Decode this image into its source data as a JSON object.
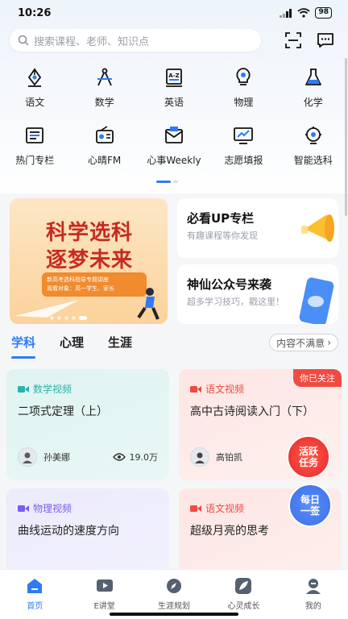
{
  "status": {
    "time": "10:26",
    "battery": "98"
  },
  "search": {
    "placeholder": "搜索课程、老师、知识点"
  },
  "grid": {
    "row1": [
      {
        "label": "语文",
        "icon": "pen-nib-icon"
      },
      {
        "label": "数学",
        "icon": "compass-icon"
      },
      {
        "label": "英语",
        "icon": "az-book-icon"
      },
      {
        "label": "物理",
        "icon": "lightbulb-icon"
      },
      {
        "label": "化学",
        "icon": "flask-icon"
      }
    ],
    "row2": [
      {
        "label": "热门专栏",
        "icon": "newspaper-icon"
      },
      {
        "label": "心晴FM",
        "icon": "radio-icon"
      },
      {
        "label": "心事Weekly",
        "icon": "envelope-icon"
      },
      {
        "label": "志愿填报",
        "icon": "chart-board-icon"
      },
      {
        "label": "智能选科",
        "icon": "bulb-gear-icon"
      }
    ]
  },
  "banner": {
    "line1": "科学选科",
    "line2": "逐梦未来",
    "box_line1": "新高考选科指导专题讲座",
    "box_line2": "观看对象：高一学生、家长"
  },
  "promos": [
    {
      "title": "必看UP专栏",
      "subtitle": "有趣课程等你发现"
    },
    {
      "title": "神仙公众号来袭",
      "subtitle": "超多学习技巧，戳这里！"
    }
  ],
  "tabs": [
    "学科",
    "心理",
    "生涯"
  ],
  "unsatisfied": "内容不满意",
  "cards": [
    {
      "category": "数学视频",
      "title": "二项式定理（上）",
      "teacher": "孙美娜",
      "views": "19.0万",
      "accent": "#2bb3a8"
    },
    {
      "category": "语文视频",
      "title": "高中古诗阅读入门（下）",
      "teacher": "高铂凯",
      "tag": "你已关注",
      "accent": "#f04a42"
    },
    {
      "category": "物理视频",
      "title": "曲线运动的速度方向",
      "accent": "#7a5cf0"
    },
    {
      "category": "语文视频",
      "title": "超级月亮的思考",
      "accent": "#f04a42"
    }
  ],
  "badges": {
    "active_task": "活跃任务",
    "daily": "每日一签"
  },
  "nav": [
    {
      "label": "首页",
      "icon": "home-icon"
    },
    {
      "label": "E讲堂",
      "icon": "play-icon"
    },
    {
      "label": "生涯规划",
      "icon": "compass-nav-icon"
    },
    {
      "label": "心灵成长",
      "icon": "leaf-icon"
    },
    {
      "label": "我的",
      "icon": "user-icon"
    }
  ],
  "colors": {
    "accent": "#2f7bf5"
  }
}
